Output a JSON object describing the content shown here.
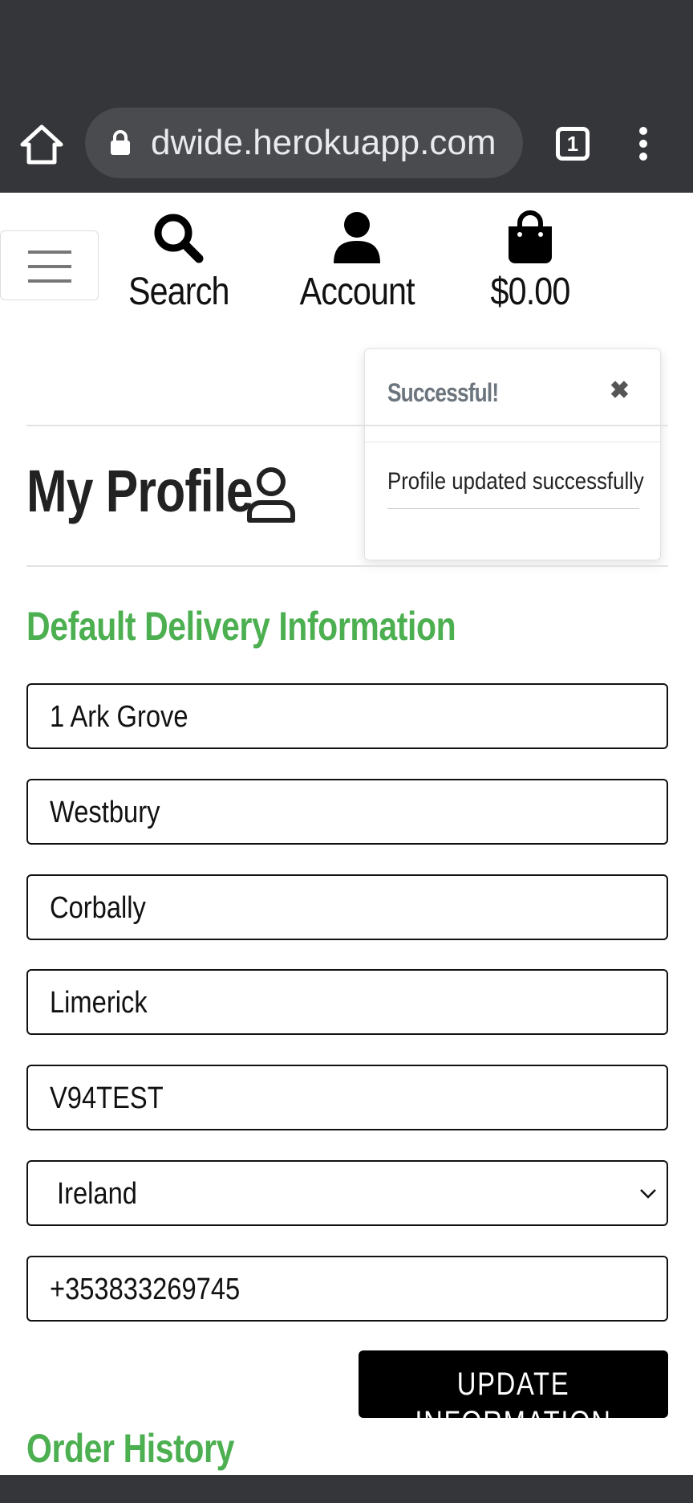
{
  "browser": {
    "url": "dwide.herokuapp.com",
    "tab_count": "1"
  },
  "nav": {
    "search_label": "Search",
    "account_label": "Account",
    "cart_total": "$0.00"
  },
  "toast": {
    "title": "Successful!",
    "close_glyph": "✖",
    "message": "Profile updated successfully"
  },
  "profile": {
    "title": "My Profile"
  },
  "delivery": {
    "heading": "Default Delivery Information",
    "street_address1": "1 Ark Grove",
    "street_address2": "Westbury",
    "town_or_city": "Corbally",
    "county": "Limerick",
    "postcode": "V94TEST",
    "country": "Ireland",
    "phone_number": "+353833269745",
    "update_label": "UPDATE INFORMATION"
  },
  "orders": {
    "heading": "Order History"
  },
  "colors": {
    "accent_green": "#4caf50",
    "browser_chrome": "#35363a",
    "button_black": "#000000"
  }
}
